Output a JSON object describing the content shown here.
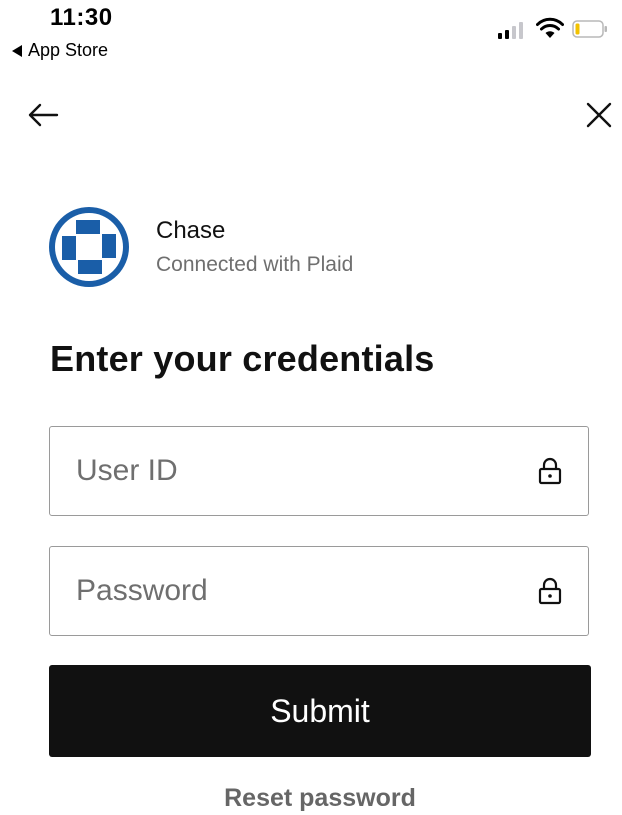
{
  "status_bar": {
    "time": "11:30",
    "back_app": "App Store"
  },
  "nav": {
    "back_icon": "arrow-left-icon",
    "close_icon": "close-icon"
  },
  "institution": {
    "name": "Chase",
    "subtitle": "Connected with Plaid",
    "brand_color": "#1a5ea8"
  },
  "form": {
    "heading": "Enter your credentials",
    "user_id_placeholder": "User ID",
    "password_placeholder": "Password",
    "submit_label": "Submit",
    "reset_label": "Reset password"
  }
}
